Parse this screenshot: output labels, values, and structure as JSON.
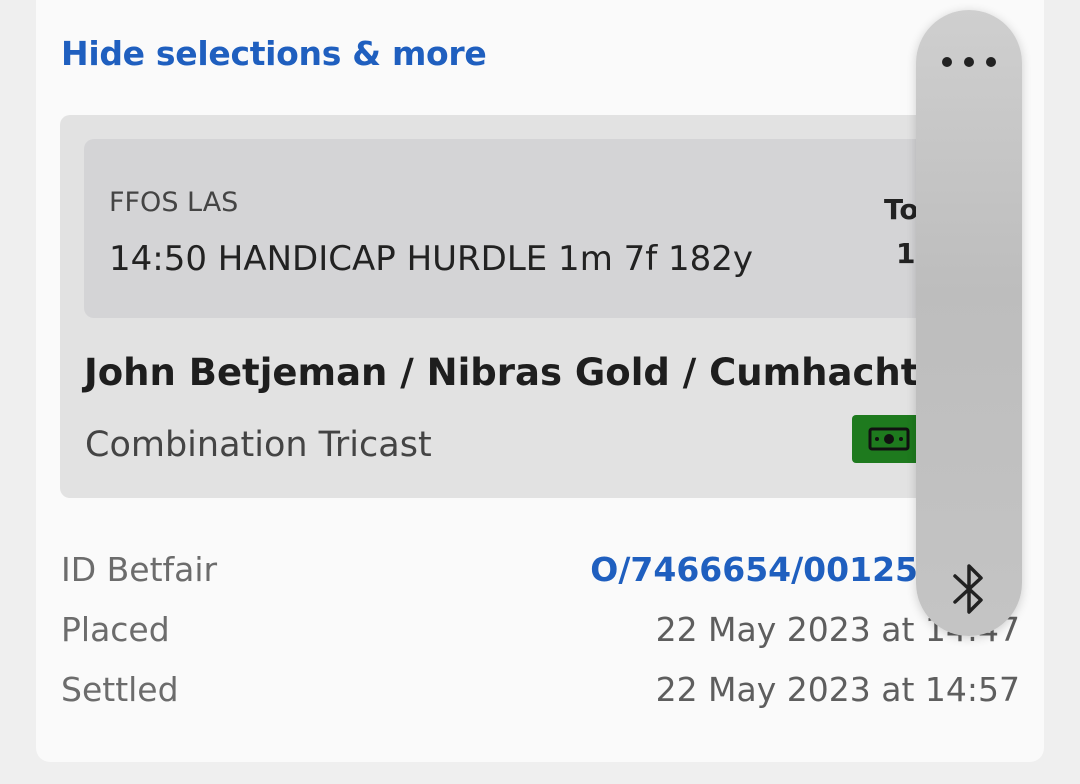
{
  "card": {
    "toggle_label": "Hide selections & more"
  },
  "race": {
    "venue": "FFOS LAS",
    "name": "14:50 HANDICAP HURDLE 1m 7f 182y",
    "total_label": "To",
    "total_value": "1"
  },
  "bet": {
    "selections": "John Betjeman / Nibras Gold / Cumhacht",
    "type": "Combination Tricast",
    "badge_icon": "cash-icon",
    "badge_color": "#1e7a1e"
  },
  "meta": {
    "id_label": "ID Betfair",
    "id_value": "O/7466654/00125",
    "placed_label": "Placed",
    "placed_value": "22 May 2023 at 14:47",
    "settled_label": "Settled",
    "settled_value": "22 May 2023 at 14:57"
  },
  "overlay": {
    "menu_icon": "more-dots-icon",
    "bluetooth_icon": "bluetooth-icon"
  },
  "colors": {
    "link": "#1f5fbf",
    "background": "#efefef",
    "card": "#fafafa"
  }
}
